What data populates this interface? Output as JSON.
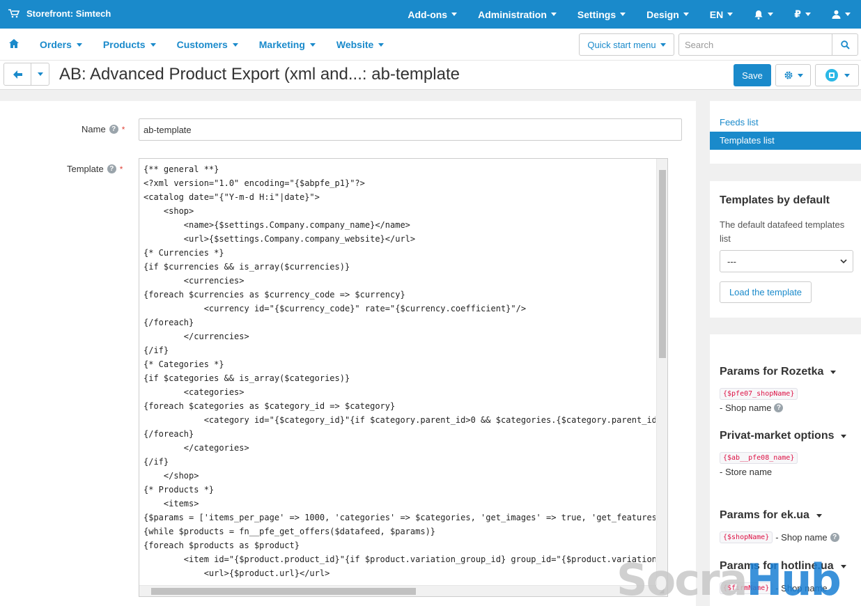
{
  "topbar": {
    "store_title": "Storefront: Simtech",
    "menu": [
      {
        "label": "Add-ons"
      },
      {
        "label": "Administration"
      },
      {
        "label": "Settings"
      },
      {
        "label": "Design"
      },
      {
        "label": "EN"
      },
      {
        "label": ""
      },
      {
        "label": "₽"
      },
      {
        "label": ""
      }
    ]
  },
  "navbar": {
    "items": [
      {
        "label": "Orders"
      },
      {
        "label": "Products"
      },
      {
        "label": "Customers"
      },
      {
        "label": "Marketing"
      },
      {
        "label": "Website"
      }
    ],
    "quick_start_label": "Quick start menu",
    "search_placeholder": "Search"
  },
  "titlebar": {
    "title": "AB: Advanced Product Export (xml and...: ab-template",
    "save_label": "Save"
  },
  "form": {
    "name_label": "Name",
    "name_value": "ab-template",
    "template_label": "Template",
    "template_lines": [
      "{** general **}",
      "<?xml version=\"1.0\" encoding=\"{$abpfe_p1}\"?>",
      "<catalog date=\"{\"Y-m-d H:i\"|date}\">",
      "    <shop>",
      "        <name>{$settings.Company.company_name}</name>",
      "        <url>{$settings.Company.company_website}</url>",
      "{* Currencies *}",
      "{if $currencies && is_array($currencies)}",
      "        <currencies>",
      "{foreach $currencies as $currency_code => $currency}",
      "            <currency id=\"{$currency_code}\" rate=\"{$currency.coefficient}\"/>",
      "{/foreach}",
      "        </currencies>",
      "{/if}",
      "{* Categories *}",
      "{if $categories && is_array($categories)}",
      "        <categories>",
      "{foreach $categories as $category_id => $category}",
      "            <category id=\"{$category_id}\"{if $category.parent_id>0 && $categories.{$category.parent_id}",
      "{/foreach}",
      "        </categories>",
      "{/if}",
      "    </shop>",
      "{* Products *}",
      "    <items>",
      "{$params = ['items_per_page' => 1000, 'categories' => $categories, 'get_images' => true, 'get_features'",
      "{while $products = fn__pfe_get_offers($datafeed, $params)}",
      "{foreach $products as $product}",
      "        <item id=\"{$product.product_id}\"{if $product.variation_group_id} group_id=\"{$product.variation_",
      "            <url>{$product.url}</url>"
    ]
  },
  "sidebar": {
    "links": [
      {
        "label": "Feeds list"
      },
      {
        "label": "Templates list"
      }
    ],
    "defaults": {
      "title": "Templates by default",
      "description": "The default datafeed templates list",
      "select_value": "---",
      "load_label": "Load the template"
    },
    "params": [
      {
        "title": "Params for Rozetka",
        "code": "{$pfe07_shopName}",
        "text": "- Shop name"
      },
      {
        "title": "Privat-market options",
        "code": "{$ab__pfe08_name}",
        "text": "- Store name"
      },
      {
        "title": "Params for ek.ua",
        "code": "{$shopName}",
        "text": "- Shop name"
      },
      {
        "title": "Params for hotline.ua",
        "code": "{$firmName}",
        "text": "- Shop name"
      }
    ]
  },
  "watermark": {
    "part1": "Socra",
    "part2": "Hub"
  },
  "colors": {
    "accent": "#1a8acb",
    "required": "#e0443a",
    "code_tag": "#dd1144"
  }
}
